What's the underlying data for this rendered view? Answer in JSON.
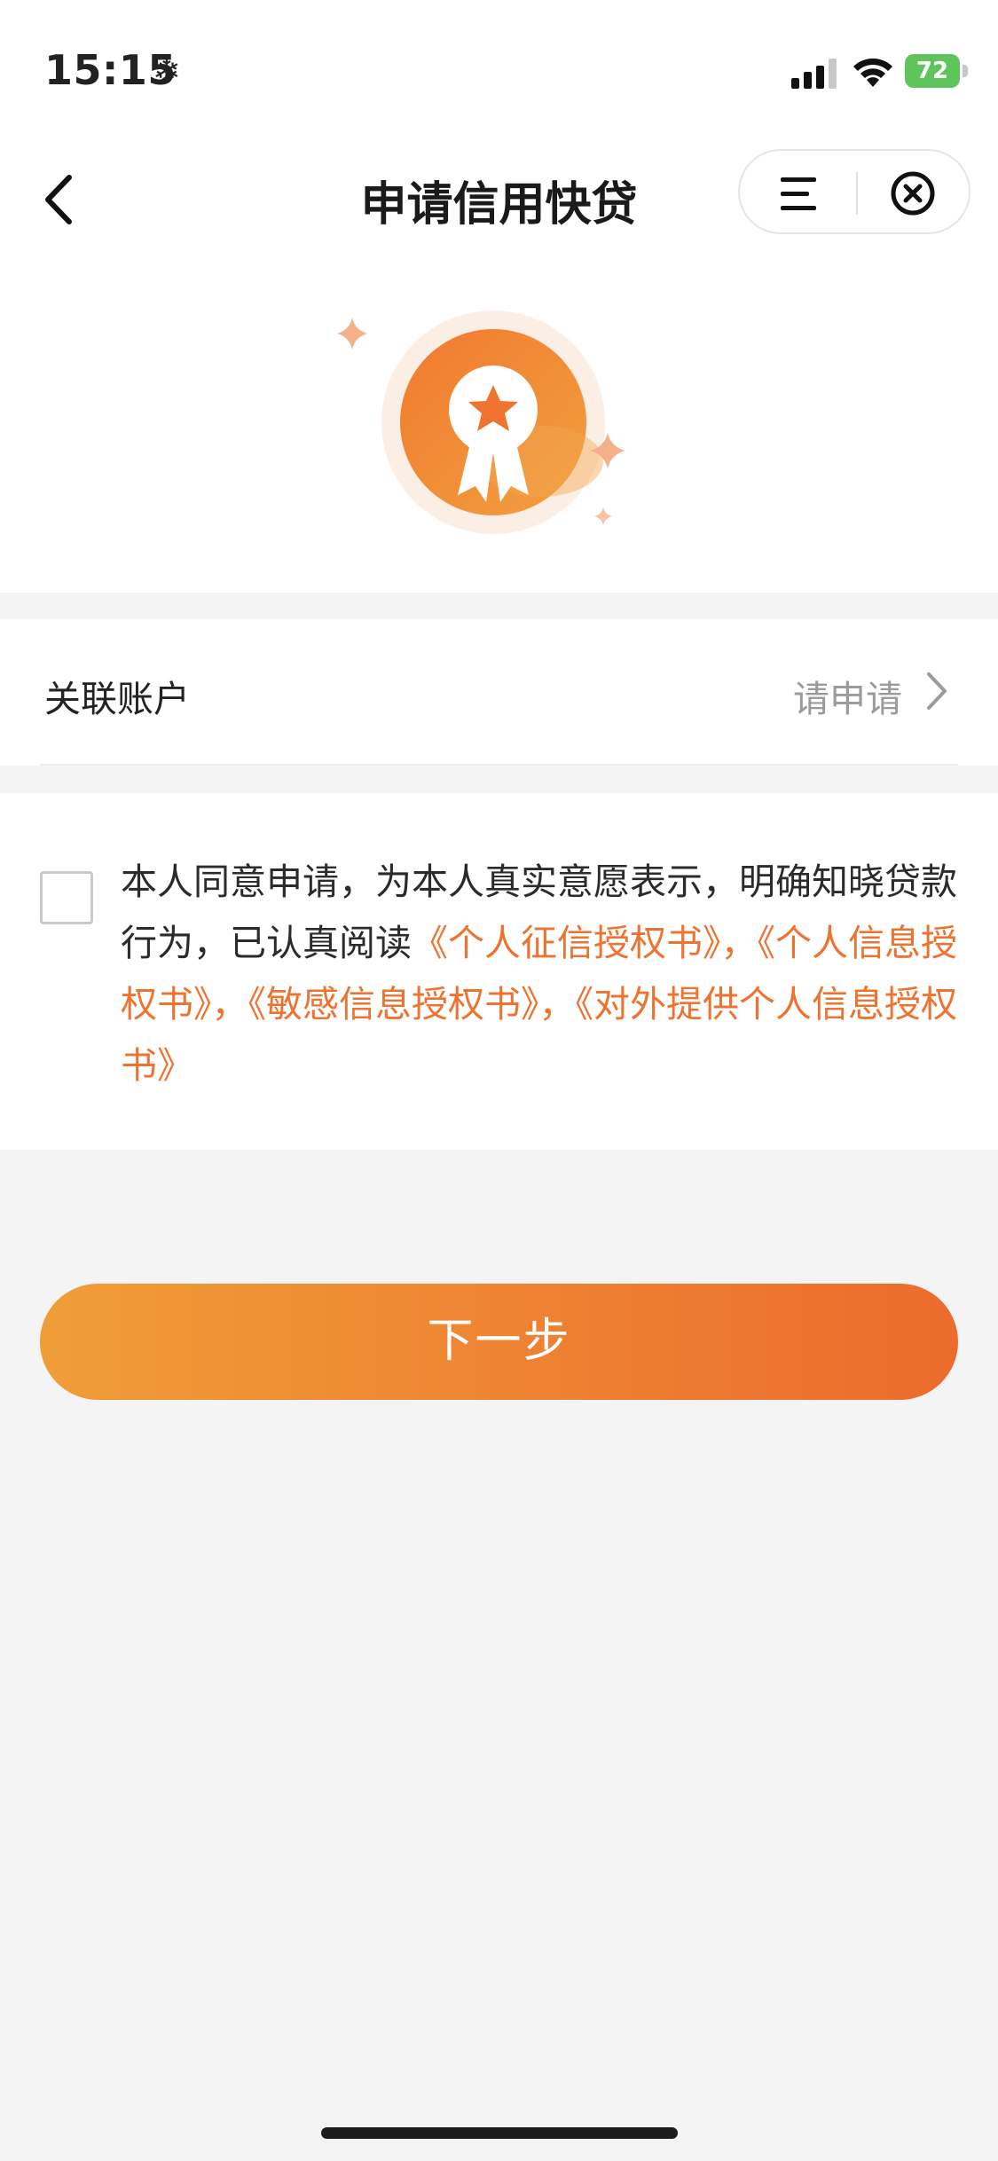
{
  "status_bar": {
    "time": "15:15",
    "weather_icon": "snowflake-icon",
    "battery_level": "72"
  },
  "nav": {
    "title": "申请信用快贷",
    "back_icon": "chevron-left-icon",
    "menu_icon": "menu-icon",
    "close_icon": "close-circle-icon"
  },
  "hero": {
    "icon": "award-badge-icon"
  },
  "account": {
    "label": "关联账户",
    "value": "请申请"
  },
  "agreement": {
    "checked": false,
    "text_prefix": "本人同意申请，为本人真实意愿表示，明确知晓贷款行为，已认真阅读",
    "links": [
      "《个人征信授权书》",
      "《个人信息授权书》",
      "《敏感信息授权书》",
      "《对外提供个人信息授权书》"
    ],
    "separator": "，"
  },
  "next_button": {
    "label": "下一步"
  },
  "colors": {
    "accent": "#ef7330",
    "gradient_start": "#f09d38",
    "gradient_end": "#ec6b2d",
    "background": "#f4f4f4"
  }
}
